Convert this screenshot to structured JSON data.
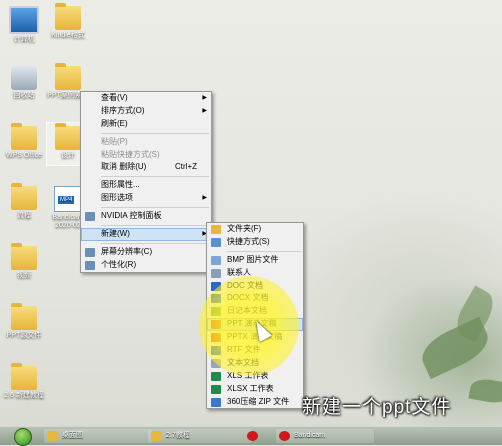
{
  "desktop": {
    "icons": [
      {
        "label": "计算机",
        "kind": "pc"
      },
      {
        "label": "Kindle格式",
        "kind": "folder"
      },
      {
        "label": "回收站",
        "kind": "bin"
      },
      {
        "label": "PPT案例素材",
        "kind": "folder"
      },
      {
        "label": "WPS Office",
        "kind": "wps"
      },
      {
        "label": "设计",
        "kind": "folder"
      },
      {
        "label": "流程",
        "kind": "folder"
      },
      {
        "label": "Bandicam 2020-02",
        "kind": "mp4",
        "badge": "MP4"
      },
      {
        "label": "视频",
        "kind": "folder"
      },
      {
        "label": "PPT源文件",
        "kind": "folder"
      },
      {
        "label": "2.6 新建教程",
        "kind": "folder"
      },
      {
        "label": "2.7课程",
        "kind": "folder"
      }
    ]
  },
  "context_menu": {
    "items": [
      {
        "label": "查看(V)",
        "submenu": true
      },
      {
        "label": "排序方式(O)",
        "submenu": true
      },
      {
        "label": "刷新(E)"
      },
      {
        "separator": true
      },
      {
        "label": "粘贴(P)",
        "disabled": true
      },
      {
        "label": "粘贴快捷方式(S)",
        "disabled": true
      },
      {
        "label": "取消 删除(U)",
        "shortcut": "Ctrl+Z"
      },
      {
        "separator": true
      },
      {
        "label": "图形属性..."
      },
      {
        "label": "图形选项",
        "submenu": true
      },
      {
        "separator": true
      },
      {
        "label": "NVIDIA 控制面板",
        "icon": "nvidia-icon"
      },
      {
        "separator": true
      },
      {
        "label": "新建(W)",
        "submenu": true,
        "highlighted": true
      },
      {
        "separator": true
      },
      {
        "label": "屏幕分辨率(C)",
        "icon": "display-icon"
      },
      {
        "label": "个性化(R)",
        "icon": "personalize-icon"
      }
    ]
  },
  "new_submenu": {
    "items": [
      {
        "label": "文件夹(F)",
        "icon": "folder-icon",
        "color": "#e8b83c"
      },
      {
        "label": "快捷方式(S)",
        "icon": "shortcut-icon",
        "color": "#5a8fd0"
      },
      {
        "separator": true
      },
      {
        "label": "BMP 图片文件",
        "icon": "bmp-icon",
        "color": "#7aa7d8"
      },
      {
        "label": "联系人",
        "icon": "contact-icon",
        "color": "#8aa0b8"
      },
      {
        "label": "DOC 文档",
        "icon": "doc-icon",
        "color": "#2b65c6"
      },
      {
        "label": "DOCX 文档",
        "icon": "docx-icon",
        "color": "#2b65c6"
      },
      {
        "label": "日记本文档",
        "icon": "journal-icon",
        "color": "#6aa050"
      },
      {
        "label": "PPT 演示文稿",
        "icon": "ppt-icon",
        "color": "#d24726",
        "highlighted": true
      },
      {
        "label": "PPTX 演示文稿",
        "icon": "pptx-icon",
        "color": "#d24726"
      },
      {
        "label": "RTF 文件",
        "icon": "rtf-icon",
        "color": "#2b65c6"
      },
      {
        "label": "文本文档",
        "icon": "txt-icon",
        "color": "#9aa5b0"
      },
      {
        "label": "XLS 工作表",
        "icon": "xls-icon",
        "color": "#1f8a4c"
      },
      {
        "label": "XLSX 工作表",
        "icon": "xlsx-icon",
        "color": "#1f8a4c"
      },
      {
        "label": "360压缩 ZIP 文件",
        "icon": "zip-icon",
        "color": "#3a78c8"
      }
    ]
  },
  "caption": "新建一个ppt文件",
  "taskbar": {
    "items": [
      {
        "label": "桌面图",
        "icon": "folder-icon",
        "color": "#e8b83c"
      },
      {
        "label": "2.7教程",
        "icon": "folder-icon",
        "color": "#e8b83c"
      },
      {
        "label": "",
        "icon": "record-icon",
        "color": "#d01818"
      },
      {
        "label": "Bandicam",
        "icon": "record-icon",
        "color": "#d01818"
      }
    ]
  },
  "colors": {
    "highlight": "#fff028",
    "menu_bg": "#f0f0f0",
    "menu_hover": "#cfe3f7"
  }
}
